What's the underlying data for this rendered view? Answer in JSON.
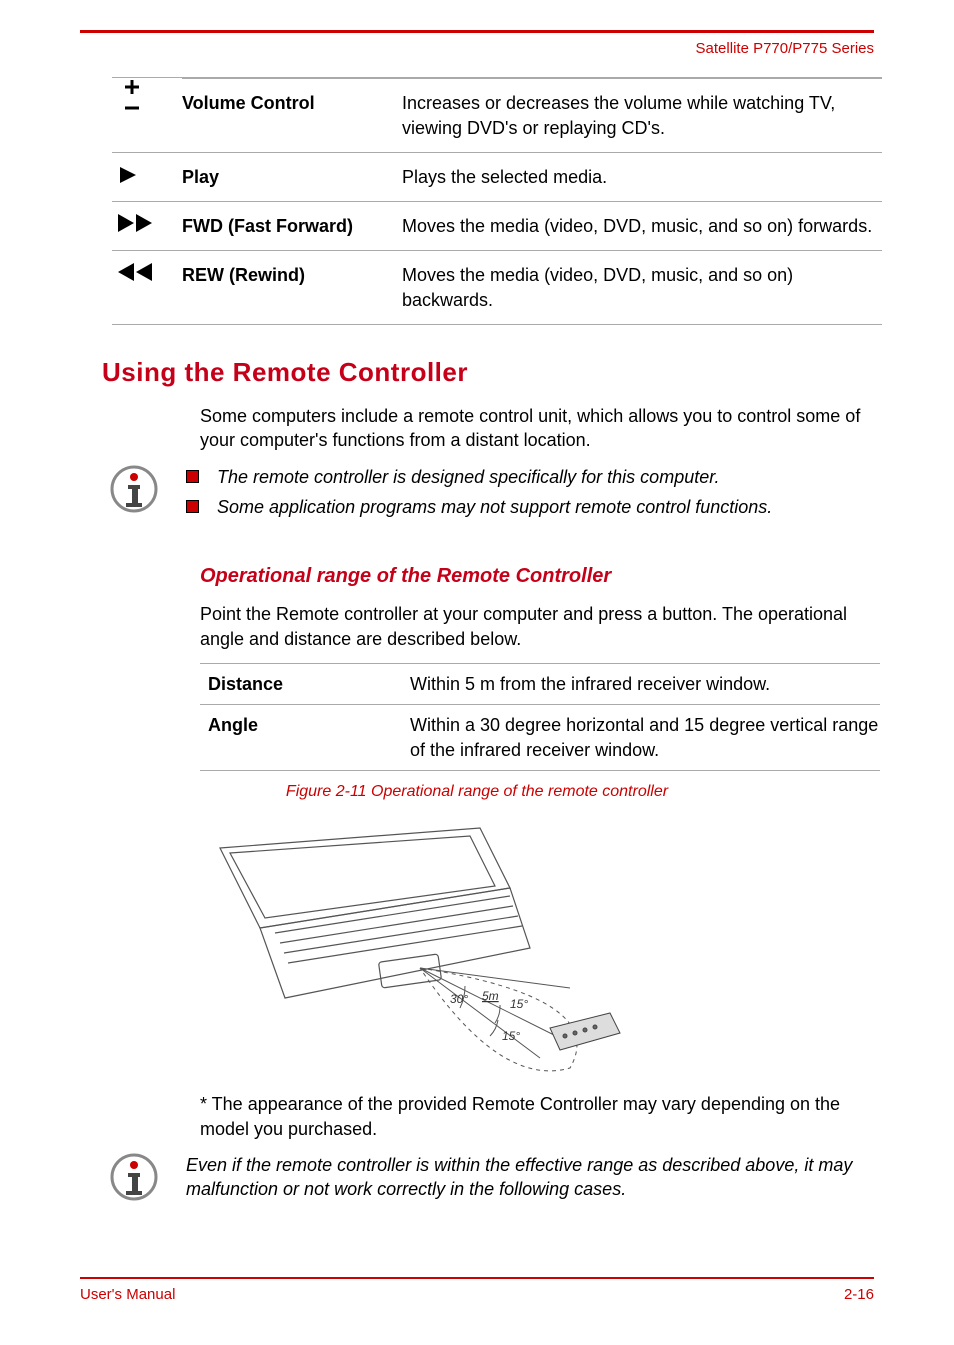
{
  "header": {
    "model": "Satellite P770/P775 Series"
  },
  "controls": [
    {
      "icon": "volume-icon",
      "label": "Volume Control",
      "desc": "Increases or decreases the volume while watching TV, viewing DVD's or replaying CD's."
    },
    {
      "icon": "play-icon",
      "label": "Play",
      "desc": "Plays the selected media."
    },
    {
      "icon": "fwd-icon",
      "label": "FWD (Fast Forward)",
      "desc": "Moves the media (video, DVD, music, and so on) forwards."
    },
    {
      "icon": "rew-icon",
      "label": "REW (Rewind)",
      "desc": "Moves the media (video, DVD, music, and so on) backwards."
    }
  ],
  "sections": {
    "remote_controller_heading": "Using the Remote Controller",
    "remote_controller_intro": "Some computers include a remote control unit, which allows you to control some of your computer's functions from a distant location.",
    "notes1": [
      "The remote controller is designed specifically for this computer.",
      "Some application programs may not support remote control functions."
    ],
    "op_range_heading": "Operational range of the Remote Controller",
    "op_range_intro": "Point the Remote controller at your computer and press a button. The operational angle and distance are described below.",
    "spec": {
      "distance_label": "Distance",
      "distance_val": "Within 5 m from the infrared receiver window.",
      "angle_label": "Angle",
      "angle_val": "Within a 30 degree horizontal and 15 degree vertical range of the infrared receiver window."
    },
    "figure_caption": "Figure 2-11 Operational range of the remote controller",
    "figure_labels": {
      "dist": "5m",
      "h": "30°",
      "v1": "15°",
      "v2": "15°"
    },
    "footnote": "* The appearance of the provided Remote Controller may vary depending on the model you purchased.",
    "note2": "Even if the remote controller is within the effective range as described above, it may malfunction or not work correctly in the following cases."
  },
  "footer": {
    "left": "User's Manual",
    "right": "2-16"
  }
}
